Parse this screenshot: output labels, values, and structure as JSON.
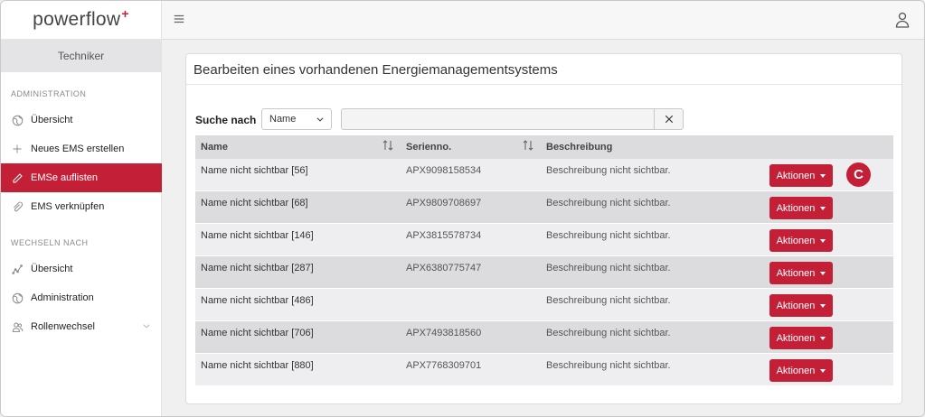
{
  "brand": {
    "name": "powerflow",
    "mark": "+"
  },
  "sidebar": {
    "role": "Techniker",
    "section_admin": "ADMINISTRATION",
    "items_admin": [
      {
        "label": "Übersicht",
        "icon": "globe-icon"
      },
      {
        "label": "Neues EMS erstellen",
        "icon": "plus-icon"
      },
      {
        "label": "EMSe auflisten",
        "icon": "pencil-icon",
        "active": true
      },
      {
        "label": "EMS verknüpfen",
        "icon": "link-icon"
      }
    ],
    "section_switch": "WECHSELN NACH",
    "items_switch": [
      {
        "label": "Übersicht",
        "icon": "chart-line-icon"
      },
      {
        "label": "Administration",
        "icon": "globe-icon"
      },
      {
        "label": "Rollenwechsel",
        "icon": "users-icon"
      }
    ]
  },
  "card": {
    "title": "Bearbeiten eines vorhandenen Energiemanagementsystems",
    "search_label": "Suche nach",
    "search_field": "Name",
    "search_value": ""
  },
  "table": {
    "headers": [
      "Name",
      "Serienno.",
      "Beschreibung"
    ],
    "action_label": "Aktionen",
    "rows": [
      {
        "name": "Name nicht sichtbar [56]",
        "serial": "APX9098158534",
        "desc": "Beschreibung nicht sichtbar."
      },
      {
        "name": "Name nicht sichtbar [68]",
        "serial": "APX9809708697",
        "desc": "Beschreibung nicht sichtbar."
      },
      {
        "name": "Name nicht sichtbar [146]",
        "serial": "APX3815578734",
        "desc": "Beschreibung nicht sichtbar."
      },
      {
        "name": "Name nicht sichtbar [287]",
        "serial": "APX6380775747",
        "desc": "Beschreibung nicht sichtbar."
      },
      {
        "name": "Name nicht sichtbar [486]",
        "serial": "",
        "desc": "Beschreibung nicht sichtbar."
      },
      {
        "name": "Name nicht sichtbar [706]",
        "serial": "APX7493818560",
        "desc": "Beschreibung nicht sichtbar."
      },
      {
        "name": "Name nicht sichtbar [880]",
        "serial": "APX7768309701",
        "desc": "Beschreibung nicht sichtbar."
      }
    ]
  },
  "badge": {
    "letter": "C"
  },
  "colors": {
    "accent": "#c32037",
    "row_light": "#eeeef0",
    "row_dark": "#dcdcde"
  }
}
